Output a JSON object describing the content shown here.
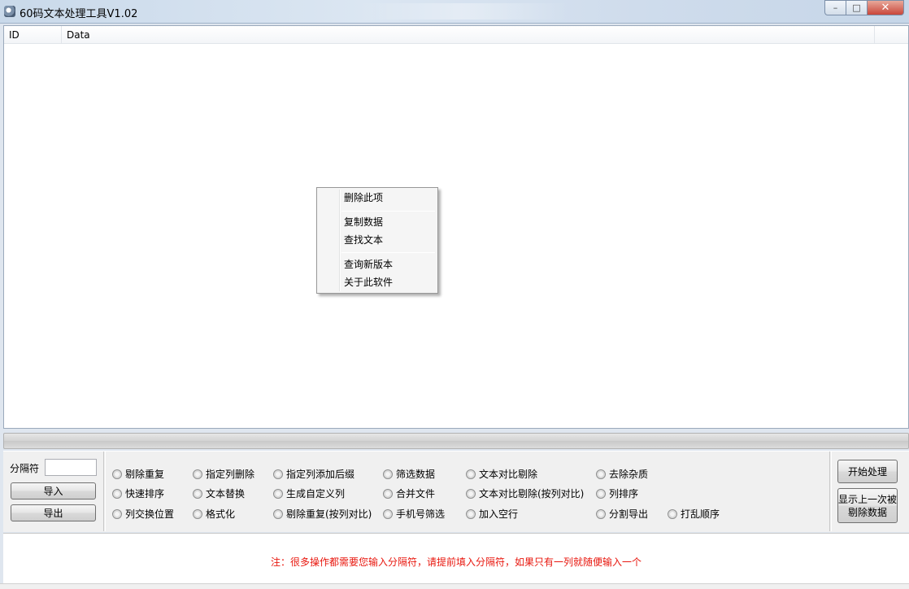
{
  "window": {
    "title": "60码文本处理工具V1.02"
  },
  "listview": {
    "columns": [
      "ID",
      "Data"
    ]
  },
  "context_menu": {
    "items": [
      "删除此项",
      "复制数据",
      "查找文本",
      "查询新版本",
      "关于此软件"
    ]
  },
  "progress": {
    "fraction": 0
  },
  "left_panel": {
    "separator_label": "分隔符",
    "separator_value": "",
    "import_label": "导入",
    "export_label": "导出"
  },
  "options": {
    "row1": [
      "剔除重复",
      "指定列删除",
      "指定列添加后缀",
      "筛选数据",
      "文本对比剔除",
      "去除杂质"
    ],
    "row2": [
      "快速排序",
      "文本替换",
      "生成自定义列",
      "合并文件",
      "文本对比剔除(按列对比)",
      "列排序"
    ],
    "row3": [
      "列交换位置",
      "格式化",
      "剔除重复(按列对比)",
      "手机号筛选",
      "加入空行",
      "分割导出",
      "打乱顺序"
    ]
  },
  "right_panel": {
    "start_label": "开始处理",
    "show_last_label": "显示上一次被剔除数据"
  },
  "note": {
    "text": "注：很多操作都需要您输入分隔符，请提前填入分隔符，如果只有一列就随便输入一个"
  },
  "colors": {
    "note_red": "#e8170e",
    "close_button": "#c9463a"
  }
}
